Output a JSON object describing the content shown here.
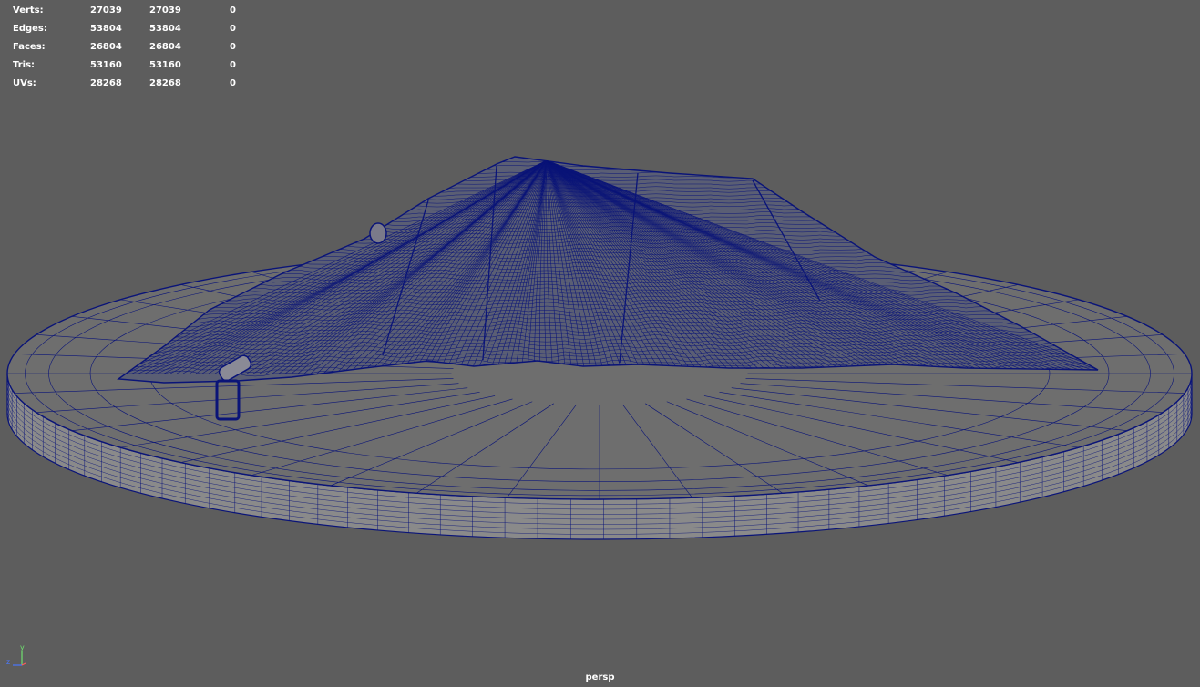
{
  "hud": {
    "rows": [
      {
        "label": "Verts:",
        "v1": "27039",
        "v2": "27039",
        "v3": "0"
      },
      {
        "label": "Edges:",
        "v1": "53804",
        "v2": "53804",
        "v3": "0"
      },
      {
        "label": "Faces:",
        "v1": "26804",
        "v2": "26804",
        "v3": "0"
      },
      {
        "label": "Tris:",
        "v1": "53160",
        "v2": "53160",
        "v3": "0"
      },
      {
        "label": "UVs:",
        "v1": "28268",
        "v2": "28268",
        "v3": "0"
      }
    ]
  },
  "viewport": {
    "camera": "persp",
    "background_color": "#5d5d5d",
    "wire_color": "#0a1478",
    "platform_top_color": "#6e6e6e",
    "platform_side_color": "#8a8a8a",
    "cloth_color": "#5a5e74"
  },
  "axis": {
    "x": "x",
    "y": "y",
    "z": "z",
    "icon": "axis-gizmo-icon"
  }
}
